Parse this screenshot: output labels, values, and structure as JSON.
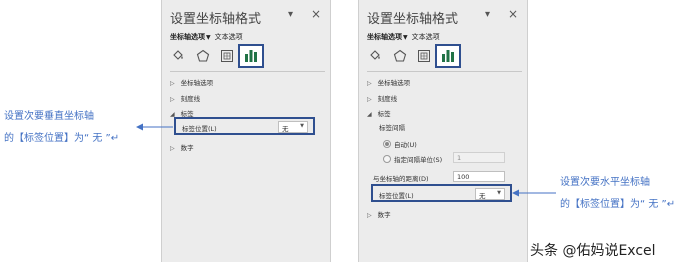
{
  "panels": [
    {
      "title": "设置坐标轴格式",
      "pin": "▾",
      "close": "×",
      "tab_active": "坐标轴选项",
      "tab_arrow": "▼",
      "tab_other": "文本选项",
      "icons": [
        "fill-icon",
        "pentagon-icon",
        "size-properties-icon",
        "bar-chart-icon"
      ],
      "sections": {
        "axis_options": "坐标轴选项",
        "tick_marks": "刻度线",
        "labels": "标签",
        "number": "数字"
      },
      "label_position": {
        "label": "标签位置(L)",
        "value": "无"
      }
    },
    {
      "title": "设置坐标轴格式",
      "pin": "▾",
      "close": "×",
      "tab_active": "坐标轴选项",
      "tab_arrow": "▼",
      "tab_other": "文本选项",
      "icons": [
        "fill-icon",
        "pentagon-icon",
        "size-properties-icon",
        "bar-chart-icon"
      ],
      "sections": {
        "axis_options": "坐标轴选项",
        "tick_marks": "刻度线",
        "labels": "标签",
        "number": "数字"
      },
      "label_interval": "标签间隔",
      "auto": "自动(U)",
      "specify_interval": "指定间隔单位(S)",
      "specify_value": "1",
      "distance": {
        "label": "与坐标轴的距离(D)",
        "value": "100"
      },
      "label_position": {
        "label": "标签位置(L)",
        "value": "无"
      }
    }
  ],
  "annotations": {
    "left_line1": "设置次要垂直坐标轴",
    "left_line2": "的【标签位置】为“ 无 ”↵",
    "right_line1": "设置次要水平坐标轴",
    "right_line2": "的【标签位置】为“ 无 ”↵"
  },
  "watermark": "头条 @佑妈说Excel",
  "colors": {
    "accent": "#2f4f8f",
    "annotation": "#4472c4",
    "panel_bg": "#ececec",
    "chart_green": "#217346"
  }
}
